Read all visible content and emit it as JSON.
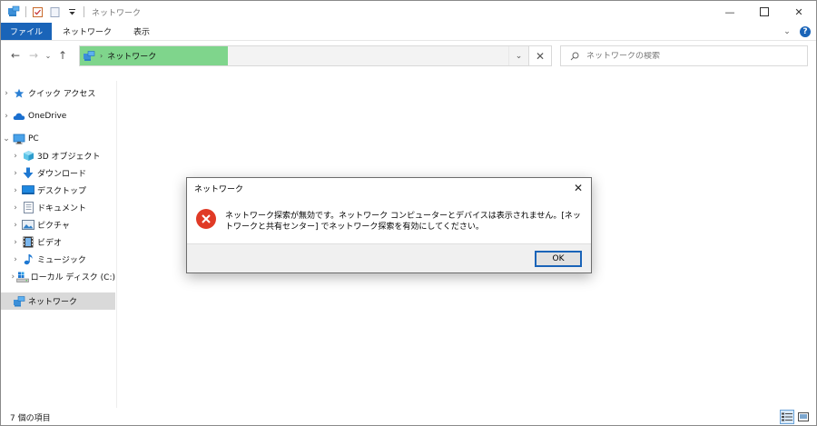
{
  "window": {
    "title": "ネットワーク"
  },
  "ribbon": {
    "tabs": [
      "ファイル",
      "ネットワーク",
      "表示"
    ]
  },
  "address": {
    "crumb": "ネットワーク"
  },
  "search": {
    "placeholder": "ネットワークの検索"
  },
  "sidebar": {
    "items": [
      {
        "label": "クイック アクセス",
        "icon": "star-icon",
        "expander": "›"
      },
      {
        "label": "OneDrive",
        "icon": "cloud-icon",
        "expander": "›"
      },
      {
        "label": "PC",
        "icon": "pc-icon",
        "expander": "⌄"
      },
      {
        "label": "3D オブジェクト",
        "icon": "cube-icon",
        "expander": "›"
      },
      {
        "label": "ダウンロード",
        "icon": "download-icon",
        "expander": "›"
      },
      {
        "label": "デスクトップ",
        "icon": "desktop-icon",
        "expander": "›"
      },
      {
        "label": "ドキュメント",
        "icon": "document-icon",
        "expander": "›"
      },
      {
        "label": "ピクチャ",
        "icon": "picture-icon",
        "expander": "›"
      },
      {
        "label": "ビデオ",
        "icon": "video-icon",
        "expander": "›"
      },
      {
        "label": "ミュージック",
        "icon": "music-icon",
        "expander": "›"
      },
      {
        "label": "ローカル ディスク (C:)",
        "icon": "disk-icon",
        "expander": "›"
      },
      {
        "label": "ネットワーク",
        "icon": "network-icon",
        "expander": ""
      }
    ]
  },
  "status": {
    "item_count": "7 個の項目"
  },
  "dialog": {
    "title": "ネットワーク",
    "message": "ネットワーク探索が無効です。ネットワーク コンピューターとデバイスは表示されません。[ネットワークと共有センター] でネットワーク探索を有効にしてください。",
    "ok_label": "OK"
  },
  "colors": {
    "accent": "#1a64b8",
    "address_highlight": "#7fd58c",
    "error": "#e03a26",
    "selected": "#d9d9d9"
  }
}
